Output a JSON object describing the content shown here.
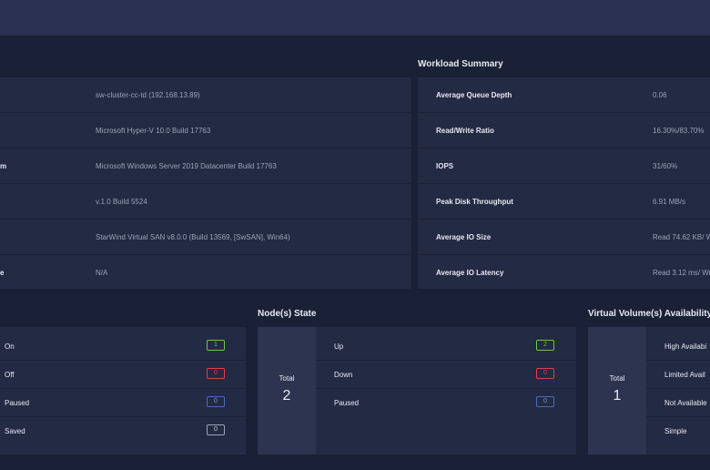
{
  "cluster_info": {
    "rows": [
      {
        "label": "",
        "value": "sw-cluster-cc-td (192.168.13.89)"
      },
      {
        "label": "",
        "value": "Microsoft Hyper-V 10.0 Build 17763"
      },
      {
        "label": "m",
        "value": "Microsoft Windows Server 2019 Datacenter Build 17763"
      },
      {
        "label": "",
        "value": "v.1.0 Build 5524"
      },
      {
        "label": "",
        "value": "StarWind Virtual SAN v8.0.0 (Build 13569, [SwSAN], Win64)"
      },
      {
        "label": "e",
        "value": "N/A"
      }
    ]
  },
  "workload_summary": {
    "title": "Workload Summary",
    "rows": [
      {
        "label": "Average Queue Depth",
        "value": "0.06"
      },
      {
        "label": "Read/Write Ratio",
        "value": "16.30%/83.70%"
      },
      {
        "label": "IOPS",
        "value": "31/60%"
      },
      {
        "label": "Peak Disk Throughput",
        "value": "6.91 MB/s"
      },
      {
        "label": "Average IO Size",
        "value": "Read 74.62 KB/ W"
      },
      {
        "label": "Average IO Latency",
        "value": "Read 3.12 ms/ Wr"
      }
    ]
  },
  "vm_state": {
    "items": [
      {
        "label": "On",
        "count": "1",
        "color": "#6fc44a"
      },
      {
        "label": "Off",
        "count": "0",
        "color": "#e23d4e"
      },
      {
        "label": "Paused",
        "count": "0",
        "color": "#4b6cb8"
      },
      {
        "label": "Saved",
        "count": "0",
        "color": "#9aa3b8"
      }
    ]
  },
  "node_state": {
    "title": "Node(s) State",
    "total_label": "Total",
    "total_value": "2",
    "items": [
      {
        "label": "Up",
        "count": "2",
        "color": "#6fc44a"
      },
      {
        "label": "Down",
        "count": "0",
        "color": "#e23d4e"
      },
      {
        "label": "Paused",
        "count": "0",
        "color": "#4b6cb8"
      }
    ]
  },
  "volume_availability": {
    "title": "Virtual Volume(s) Availability",
    "total_label": "Total",
    "total_value": "1",
    "items": [
      {
        "label": "High Availabi"
      },
      {
        "label": "Limited Avail"
      },
      {
        "label": "Not Available"
      },
      {
        "label": "Simple"
      }
    ]
  }
}
